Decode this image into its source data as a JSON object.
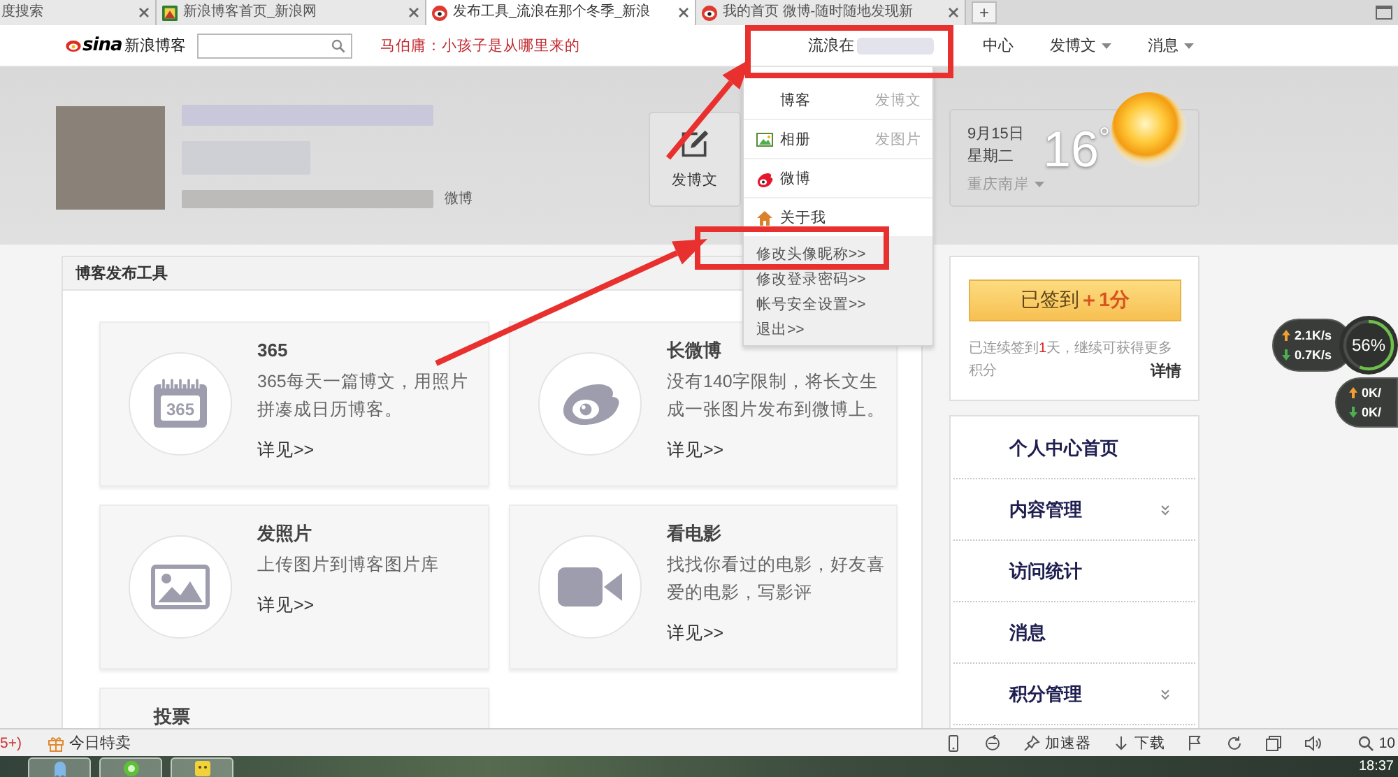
{
  "browser_tabs": [
    {
      "title": "度搜索",
      "selected": false
    },
    {
      "title": "新浪博客首页_新浪网",
      "selected": false
    },
    {
      "title": "发布工具_流浪在那个冬季_新浪",
      "selected": true
    },
    {
      "title": "我的首页 微博-随时随地发现新",
      "selected": false
    }
  ],
  "new_tab": "+",
  "header": {
    "logo": {
      "brand": "sina",
      "name": "新浪博客"
    },
    "headline": "马伯庸：小孩子是从哪里来的",
    "user_menu": "流浪在",
    "nav": [
      {
        "label": "中心",
        "caret": false
      },
      {
        "label": "发博文",
        "caret": true
      },
      {
        "label": "消息",
        "caret": true
      }
    ]
  },
  "user_dropdown": {
    "items": [
      {
        "label": "博客",
        "action": "发博文"
      },
      {
        "label": "相册",
        "action": "发图片"
      },
      {
        "label": "微博"
      },
      {
        "label": "关于我"
      }
    ],
    "links": [
      "修改头像昵称>>",
      "修改登录密码>>",
      "帐号安全设置>>",
      "退出>>"
    ]
  },
  "profile": {
    "weibo_label": "微博",
    "post_button": "发博文"
  },
  "weather": {
    "date": "9月15日",
    "weekday": "星期二",
    "temperature": "16$^{°}$",
    "location": "重庆南岸"
  },
  "publish_tools": {
    "title": "博客发布工具",
    "tools": [
      {
        "title": "365",
        "icon_text": "365",
        "description": "365每天一篇博文，用照片拼凑成日历博客。",
        "link": "详见>>"
      },
      {
        "title": "长微博",
        "description": "没有140字限制，将长文生成一张图片发布到微博上。",
        "link": "详见>>"
      },
      {
        "title": "发照片",
        "description": "上传图片到博客图片库",
        "link": "详见>>"
      },
      {
        "title": "看电影",
        "description": "找找你看过的电影，好友喜爱的电影，写影评",
        "link": "详见>>"
      },
      {
        "title": "投票"
      }
    ]
  },
  "checkin": {
    "button_label": "已签到",
    "bonus": "＋1分",
    "streak_before": "已连续签到",
    "streak_days": "1",
    "streak_after": "天，继续可获得更多积分",
    "details": "详情"
  },
  "sidebar_nav": [
    {
      "label": "个人中心首页",
      "expandable": false
    },
    {
      "label": "内容管理",
      "expandable": true
    },
    {
      "label": "访问统计",
      "expandable": false
    },
    {
      "label": "消息",
      "expandable": false
    },
    {
      "label": "积分管理",
      "expandable": true
    }
  ],
  "speed_widget": {
    "upload": "2.1K/s",
    "download": "0.7K/s",
    "percent": "56%",
    "level": 0.56,
    "upload_2": "0K/",
    "download_2": "0K/"
  },
  "status_bar": {
    "left": "5+)",
    "deals": "今日特卖",
    "accelerator": "加速器",
    "download": "下载",
    "zoom": "10"
  },
  "taskbar": {
    "clock": "18:37"
  }
}
